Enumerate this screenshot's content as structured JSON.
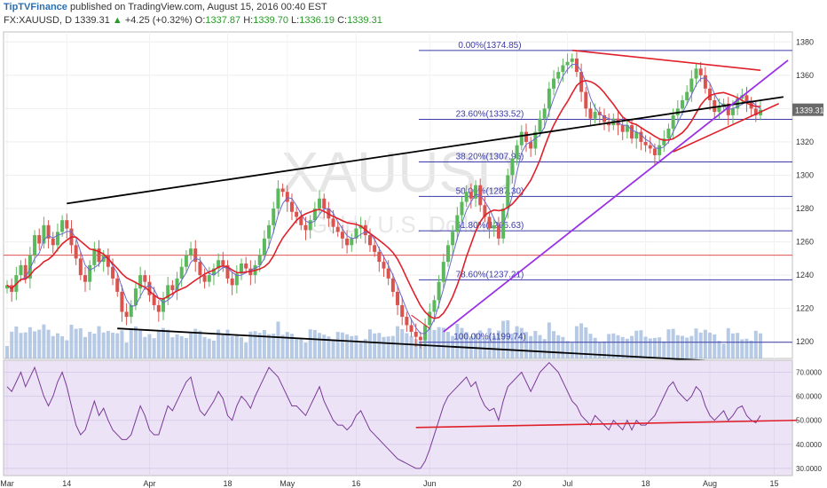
{
  "header": {
    "publisher": "TipTVFinance",
    "published_on": "published on TradingView.com, August 15, 2016 00:40 EST",
    "symbol": "FX:XAUUSD, D",
    "last": "1339.31",
    "change_arrow": "▲",
    "change": "+4.25 (+0.32%)",
    "o_label": "O:",
    "o_value": "1337.87",
    "h_label": "H:",
    "h_value": "1339.70",
    "l_label": "L:",
    "l_value": "1336.19",
    "c_label": "C:",
    "c_value": "1339.31"
  },
  "watermark": {
    "symbol": "XAUUSD",
    "sub": "Gold / U.S. Dollar"
  },
  "colors": {
    "up": "#5cb85c",
    "down": "#d9534f",
    "sma": "#e0202a",
    "ema": "#6a6ad0",
    "fib": "#3a3aa8",
    "rsi": "#7a3a98",
    "rsi_bg": "#ece4f6",
    "volume": "#9fb8dc",
    "trend_black": "#000000",
    "trend_purple": "#9b30e6",
    "trend_red": "#e0202a"
  },
  "chart_data": [
    {
      "type": "candlestick",
      "symbol": "FX:XAUUSD",
      "timeframe": "D",
      "ylim": [
        1190,
        1386
      ],
      "y_ticks": [
        1200,
        1220,
        1240,
        1260,
        1280,
        1300,
        1320,
        1340,
        1360,
        1380
      ],
      "x_ticks": [
        {
          "label": "Mar",
          "day": 0
        },
        {
          "label": "14",
          "day": 13
        },
        {
          "label": "Apr",
          "day": 31
        },
        {
          "label": "18",
          "day": 48
        },
        {
          "label": "May",
          "day": 61
        },
        {
          "label": "16",
          "day": 76
        },
        {
          "label": "Jun",
          "day": 92
        },
        {
          "label": "20",
          "day": 111
        },
        {
          "label": "Jul",
          "day": 122
        },
        {
          "label": "18",
          "day": 139
        },
        {
          "label": "Aug",
          "day": 153
        },
        {
          "label": "15",
          "day": 167
        }
      ],
      "last_price_label": "1339.31",
      "horizontal_level": 1252,
      "fib_levels": [
        {
          "label": "0.00%(1374.85)",
          "value": 1374.85
        },
        {
          "label": "23.60%(1333.52)",
          "value": 1333.52
        },
        {
          "label": "38.20%(1307.96)",
          "value": 1307.96
        },
        {
          "label": "50.00%(1287.30)",
          "value": 1287.3
        },
        {
          "label": "61.80%(1266.63)",
          "value": 1266.63
        },
        {
          "label": "78.60%(1237.21)",
          "value": 1237.21
        },
        {
          "label": "100.00%(1199.74)",
          "value": 1199.74
        }
      ],
      "closes": [
        1234,
        1230,
        1240,
        1246,
        1238,
        1252,
        1264,
        1259,
        1270,
        1262,
        1258,
        1266,
        1273,
        1268,
        1258,
        1250,
        1240,
        1236,
        1246,
        1256,
        1248,
        1252,
        1245,
        1238,
        1230,
        1218,
        1215,
        1222,
        1232,
        1240,
        1236,
        1228,
        1222,
        1218,
        1226,
        1234,
        1231,
        1238,
        1245,
        1252,
        1256,
        1248,
        1240,
        1236,
        1240,
        1244,
        1249,
        1246,
        1238,
        1234,
        1241,
        1247,
        1244,
        1240,
        1246,
        1252,
        1262,
        1270,
        1280,
        1292,
        1290,
        1284,
        1278,
        1275,
        1270,
        1267,
        1273,
        1280,
        1286,
        1280,
        1274,
        1269,
        1266,
        1262,
        1258,
        1262,
        1268,
        1270,
        1264,
        1258,
        1254,
        1248,
        1244,
        1238,
        1230,
        1222,
        1215,
        1210,
        1206,
        1203,
        1201,
        1210,
        1218,
        1225,
        1236,
        1248,
        1258,
        1266,
        1276,
        1284,
        1290,
        1286,
        1294,
        1282,
        1275,
        1268,
        1270,
        1262,
        1280,
        1300,
        1310,
        1318,
        1326,
        1320,
        1316,
        1326,
        1334,
        1340,
        1352,
        1358,
        1362,
        1366,
        1368,
        1370,
        1362,
        1350,
        1340,
        1334,
        1338,
        1336,
        1332,
        1330,
        1334,
        1330,
        1326,
        1330,
        1322,
        1326,
        1320,
        1318,
        1316,
        1312,
        1318,
        1322,
        1328,
        1336,
        1340,
        1345,
        1350,
        1358,
        1364,
        1360,
        1352,
        1345,
        1338,
        1341,
        1343,
        1336,
        1340,
        1346,
        1348,
        1344,
        1340,
        1336,
        1339.31
      ],
      "rsi": {
        "ylim": [
          27,
          75
        ],
        "y_ticks": [
          30,
          40,
          50,
          60,
          70
        ],
        "tick_labels": [
          "30.0000",
          "40.0000",
          "50.0000",
          "60.0000",
          "70.0000"
        ],
        "values": [
          64,
          62,
          66,
          70,
          64,
          68,
          72,
          66,
          60,
          56,
          60,
          66,
          70,
          64,
          56,
          48,
          44,
          46,
          52,
          58,
          52,
          55,
          50,
          46,
          44,
          42,
          42,
          44,
          50,
          56,
          52,
          46,
          44,
          44,
          50,
          56,
          54,
          58,
          62,
          66,
          68,
          60,
          54,
          52,
          55,
          58,
          62,
          59,
          52,
          50,
          56,
          60,
          58,
          55,
          60,
          64,
          68,
          72,
          70,
          68,
          64,
          60,
          56,
          56,
          54,
          52,
          56,
          60,
          64,
          58,
          54,
          50,
          48,
          48,
          46,
          48,
          52,
          54,
          50,
          46,
          44,
          42,
          40,
          38,
          36,
          34,
          33,
          32,
          31,
          30,
          30,
          33,
          38,
          44,
          50,
          56,
          60,
          62,
          64,
          66,
          68,
          64,
          66,
          60,
          56,
          54,
          55,
          50,
          58,
          64,
          66,
          68,
          70,
          66,
          62,
          66,
          70,
          72,
          74,
          72,
          70,
          66,
          62,
          58,
          56,
          52,
          50,
          48,
          52,
          50,
          48,
          46,
          50,
          48,
          46,
          50,
          46,
          50,
          48,
          48,
          50,
          52,
          56,
          60,
          64,
          66,
          62,
          60,
          58,
          60,
          64,
          62,
          56,
          52,
          50,
          52,
          54,
          50,
          52,
          55,
          56,
          52,
          50,
          49,
          52
        ]
      },
      "trend_lines": [
        "black-upper",
        "black-lower",
        "purple-support",
        "red-upper",
        "red-lower",
        "red-rsi"
      ]
    }
  ]
}
